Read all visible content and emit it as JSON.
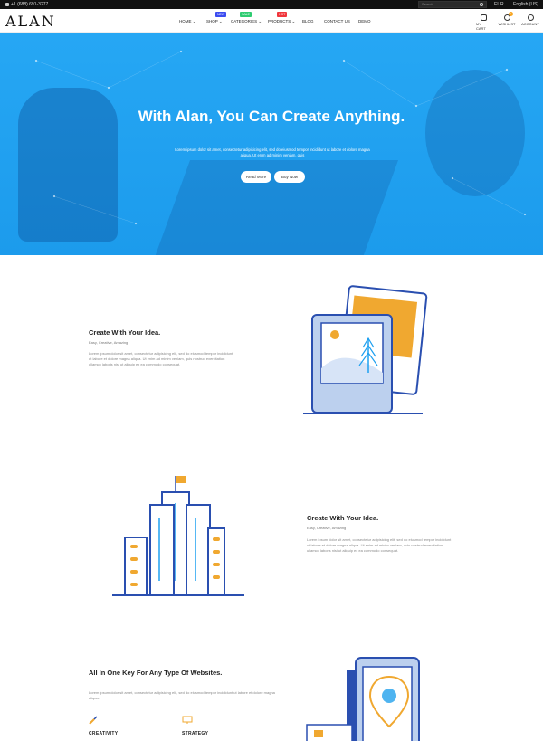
{
  "topbar": {
    "phone": "+1 (688) 691-3277",
    "search_placeholder": "Search...",
    "currency": "EUR",
    "language": "English (US)"
  },
  "header": {
    "logo": "ALAN",
    "nav": [
      {
        "label": "HOME",
        "has_caret": true
      },
      {
        "label": "SHOP",
        "has_caret": true,
        "badge": "NEW",
        "badge_color": "#3b4cf0"
      },
      {
        "label": "CATEGORIES",
        "has_caret": true,
        "badge": "SALE",
        "badge_color": "#2ecc71"
      },
      {
        "label": "PRODUCTS",
        "has_caret": true,
        "badge": "HOT",
        "badge_color": "#f0353b"
      },
      {
        "label": "BLOG"
      },
      {
        "label": "CONTACT US"
      },
      {
        "label": "DEMO"
      }
    ],
    "icons": [
      {
        "label": "MY CART",
        "icon": "cart-icon"
      },
      {
        "label": "WISHLIST",
        "icon": "heart-icon",
        "count": "0"
      },
      {
        "label": "ACCOUNT",
        "icon": "user-icon"
      }
    ]
  },
  "hero": {
    "title": "With Alan, You Can Create Anything.",
    "text": "Lorem ipsum dolor sit amet, consectetur adipisicing elit, sed do eiusmod tempor incididunt ut labore et dolore magna aliqua. Ut enim ad minim veniam, quis",
    "primary_button": "Read More",
    "secondary_button": "Buy Now"
  },
  "feature1": {
    "title": "Create With Your Idea.",
    "subtitle": "Easy, Creative, Amazing",
    "text": "Lorem ipsum dolor sit amet, consectetur adipisicing elit, sed do eiusmod tempor incididunt ut labore et dolore magna aliqua. Ut enim ad minim veniam, quis nostrud exercitation ullamco laboris nisi ut aliquip ex ea commodo consequat."
  },
  "feature2": {
    "title": "Create With Your Idea.",
    "subtitle": "Easy, Creative, Amazing",
    "text": "Lorem ipsum dolor sit amet, consectetur adipisicing elit, sed do eiusmod tempor incididunt ut labore et dolore magna aliqua. Ut enim ad minim veniam, quis nostrud exercitation ullamco laboris nisi ut aliquip ex ea commodo consequat."
  },
  "feature3": {
    "title": "All In One Key For Any Type Of Websites.",
    "text": "Lorem ipsum dolor sit amet, consectetur adipisicing elit, sed do eiusmod tempor incididunt ut labore et dolore magna aliqua.",
    "items": [
      {
        "label": "CREATIVITY",
        "icon": "brush-icon"
      },
      {
        "label": "STRATEGY",
        "icon": "monitor-icon"
      }
    ]
  },
  "colors": {
    "accent_blue": "#1ea0f0",
    "illustration_blue": "#2a4fb0",
    "illustration_orange": "#f0a830"
  }
}
